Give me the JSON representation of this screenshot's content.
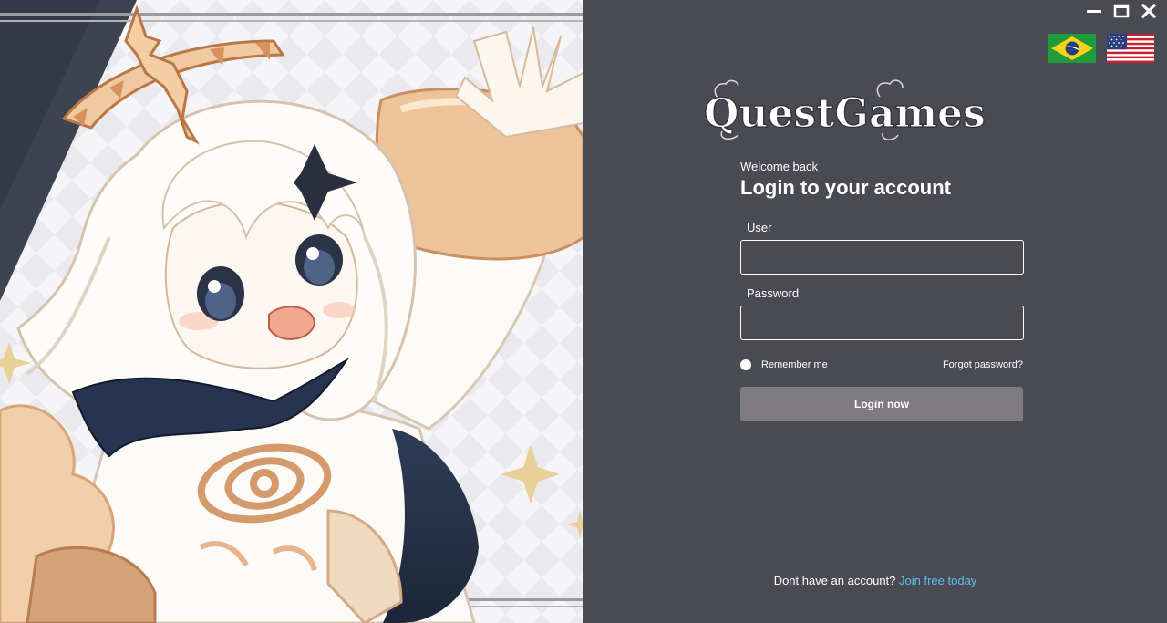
{
  "window_controls": {
    "minimize_icon": "minimize-icon",
    "maximize_icon": "maximize-icon",
    "close_icon": "close-icon"
  },
  "languages": [
    {
      "code": "pt-BR",
      "icon": "brazil-flag-icon"
    },
    {
      "code": "en-US",
      "icon": "usa-flag-icon"
    }
  ],
  "brand": {
    "logo_text": "QuestGames"
  },
  "login": {
    "welcome": "Welcome back",
    "title": "Login to your account",
    "user_label": "User",
    "user_value": "",
    "password_label": "Password",
    "password_value": "",
    "remember_label": "Remember me",
    "forgot_label": "Forgot password?",
    "submit_label": "Login now"
  },
  "signup": {
    "prompt": "Dont have an account?",
    "link": "Join free today"
  },
  "colors": {
    "panel_bg": "#4a4a53",
    "button_bg": "#7f7b80",
    "link": "#5bc0f0"
  }
}
